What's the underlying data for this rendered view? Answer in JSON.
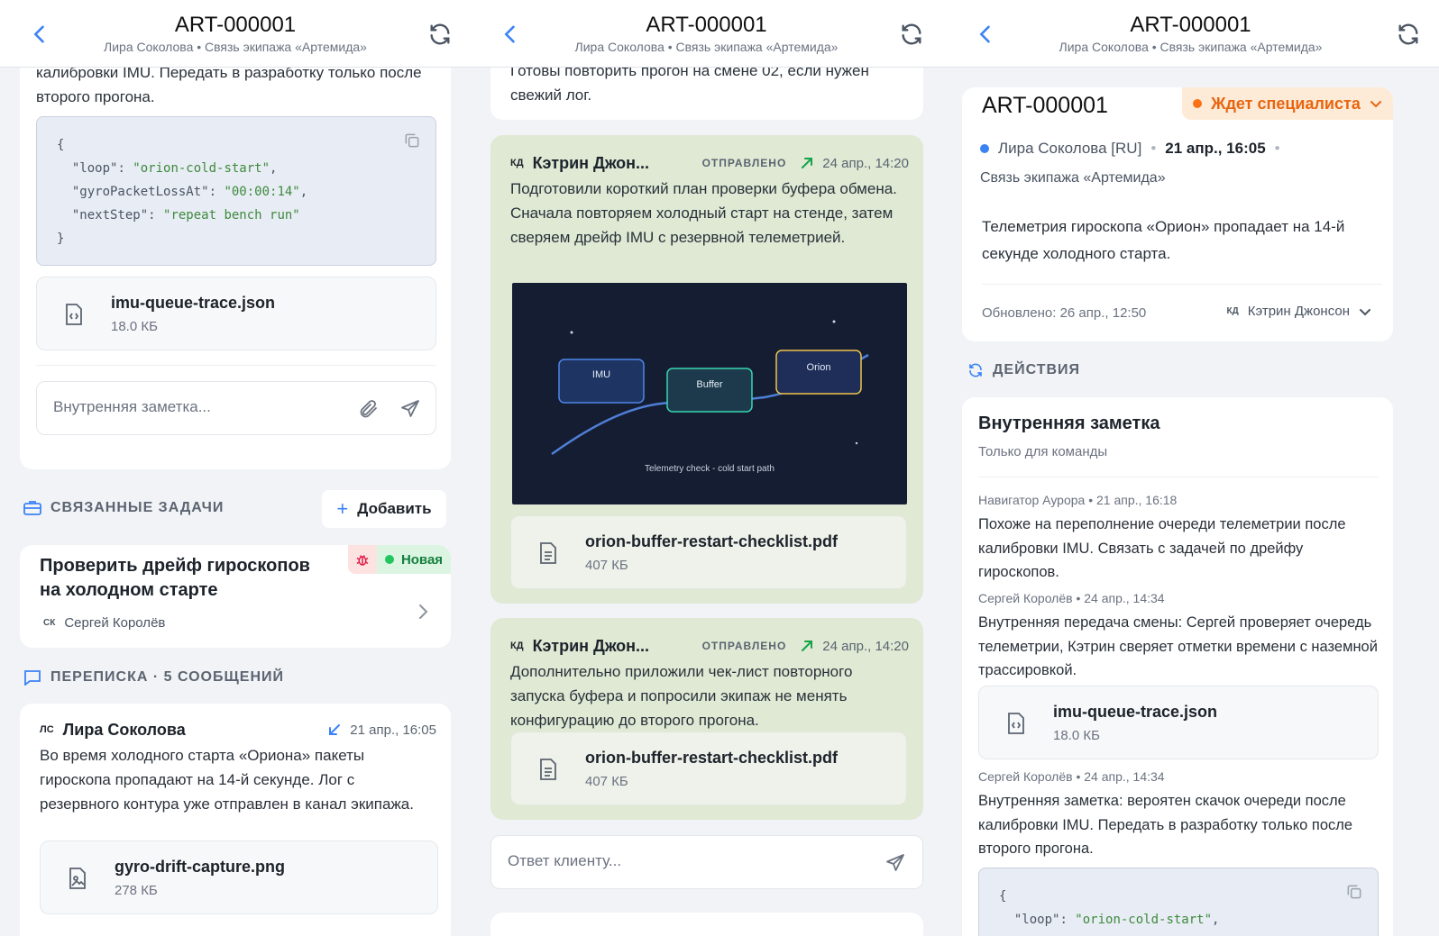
{
  "header": {
    "ticket_id": "ART-000001",
    "subtitle": "Лира Соколова • Связь экипажа «Артемида»"
  },
  "panel1": {
    "note_tail": "калибровки IMU. Передать в разработку только после второго прогона.",
    "code_lines": [
      {
        "open": "{"
      },
      {
        "key": "\"loop\"",
        "val": "\"orion-cold-start\"",
        "comma": ","
      },
      {
        "key": "\"gyroPacketLossAt\"",
        "val": "\"00:00:14\"",
        "comma": ","
      },
      {
        "key": "\"nextStep\"",
        "val": "\"repeat bench run\"",
        "comma": ""
      },
      {
        "open": "}"
      }
    ],
    "file1": {
      "name": "imu-queue-trace.json",
      "size": "18.0 КБ"
    },
    "note_input_placeholder": "Внутренняя заметка...",
    "related_section": "СВЯЗАННЫЕ ЗАДАЧИ",
    "add_label": "Добавить",
    "task": {
      "title": "Проверить дрейф гироскопов на холодном старте",
      "status": "Новая",
      "assignee_initials": "СК",
      "assignee": "Сергей Королёв"
    },
    "thread_section": "ПЕРЕПИСКА · 5 СООБЩЕНИЙ",
    "message": {
      "initials": "ЛС",
      "author": "Лира Соколова",
      "date": "21 апр., 16:05",
      "text": "Во время холодного старта «Ориона» пакеты гироскопа пропадают на 14-й секунде. Лог с резервного контура уже отправлен в канал экипажа.",
      "file": {
        "name": "gyro-drift-capture.png",
        "size": "278 КБ"
      }
    }
  },
  "panel2": {
    "top_text": "Готовы повторить прогон на смене 02, если нужен свежий лог.",
    "msg1": {
      "initials": "КД",
      "author": "Кэтрин Джон...",
      "status": "ОТПРАВЛЕНО",
      "date": "24 апр., 14:20",
      "text": "Подготовили короткий план проверки буфера обмена. Сначала повторяем холодный старт на стенде, затем сверяем дрейф IMU с резервной телеметрией.",
      "diagram": {
        "nodes": [
          "IMU",
          "Buffer",
          "Orion"
        ],
        "caption": "Telemetry check - cold start path"
      },
      "file": {
        "name": "orion-buffer-restart-checklist.pdf",
        "size": "407 КБ"
      }
    },
    "msg2": {
      "initials": "КД",
      "author": "Кэтрин Джон...",
      "status": "ОТПРАВЛЕНО",
      "date": "24 апр., 14:20",
      "text": "Дополнительно приложили чек-лист повторного запуска буфера и попросили экипаж не менять конфигурацию до второго прогона.",
      "file": {
        "name": "orion-buffer-restart-checklist.pdf",
        "size": "407 КБ"
      }
    },
    "reply_placeholder": "Ответ клиенту..."
  },
  "panel3": {
    "ticket_id": "ART-000001",
    "status": "Ждет специалиста",
    "requester": "Лира Соколова [RU]",
    "created": "21 апр., 16:05",
    "channel": "Связь экипажа «Артемида»",
    "summary": "Телеметрия гироскопа «Орион» пропадает на 14-й секунде холодного старта.",
    "updated": "Обновлено: 26 апр., 12:50",
    "assignee_initials": "КД",
    "assignee": "Кэтрин Джонсон",
    "actions_section": "ДЕЙСТВИЯ",
    "note_title": "Внутренняя заметка",
    "note_sub": "Только для команды",
    "notes": [
      {
        "meta": "Навигатор Аурора • 21 апр., 16:18",
        "text": "Похоже на переполнение очереди телеметрии после калибровки IMU. Связать с задачей по дрейфу гироскопов."
      },
      {
        "meta": "Сергей Королёв • 24 апр., 14:34",
        "text": "Внутренняя передача смены: Сергей проверяет очередь телеметрии, Кэтрин сверяет отметки времени с наземной трассировкой."
      },
      {
        "meta": "Сергей Королёв • 24 апр., 14:34",
        "text": "Внутренняя заметка: вероятен скачок очереди после калибровки IMU. Передать в разработку только после второго прогона."
      }
    ],
    "file": {
      "name": "imu-queue-trace.json",
      "size": "18.0 КБ"
    },
    "code_open": "{",
    "code_peek_key": "\"loop\"",
    "code_peek_val": "\"orion-cold-start\""
  },
  "colors": {
    "accent": "#3b82f6",
    "bubble": "#dfe9d4",
    "status_new": "#22c55e",
    "status_wait": "#f97316"
  }
}
